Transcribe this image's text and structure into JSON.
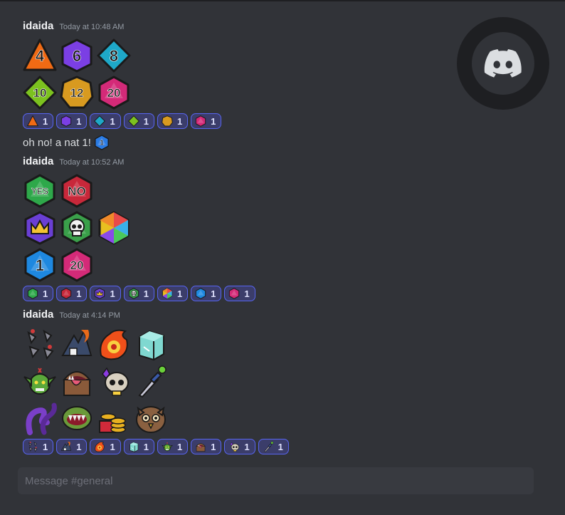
{
  "channel": {
    "composer_placeholder": "Message #general"
  },
  "colors": {
    "background": "#313338",
    "reaction_bg": "#3b3d6a",
    "reaction_border": "#5865f2",
    "username": "#f2f3f5",
    "timestamp": "#949ba4"
  },
  "messages": [
    {
      "author": "idaida",
      "time": "Today at 10:48 AM",
      "emoji_rows": [
        [
          {
            "icon": "d4-die",
            "label": "4",
            "color": "#f06a14"
          },
          {
            "icon": "d6-die",
            "label": "6",
            "color": "#7b3fe4"
          },
          {
            "icon": "d8-die",
            "label": "8",
            "color": "#1ea8c8"
          }
        ],
        [
          {
            "icon": "d10-die",
            "label": "10",
            "color": "#7cc21f"
          },
          {
            "icon": "d12-die",
            "label": "12",
            "color": "#d89a20"
          },
          {
            "icon": "d20-die",
            "label": "20",
            "color": "#d42a78"
          }
        ]
      ],
      "reactions": [
        {
          "icon": "d4-die",
          "count": "1",
          "color": "#f06a14"
        },
        {
          "icon": "d6-die",
          "count": "1",
          "color": "#7b3fe4"
        },
        {
          "icon": "d8-die",
          "count": "1",
          "color": "#1ea8c8"
        },
        {
          "icon": "d10-die",
          "count": "1",
          "color": "#7cc21f"
        },
        {
          "icon": "d12-die",
          "count": "1",
          "color": "#d89a20"
        },
        {
          "icon": "d20-die",
          "count": "1",
          "color": "#d42a78"
        }
      ],
      "followup_text": "oh no! a nat 1!",
      "followup_emoji": {
        "icon": "nat1-die",
        "color": "#2a7be4"
      }
    },
    {
      "author": "idaida",
      "time": "Today at 10:52 AM",
      "emoji_rows": [
        [
          {
            "icon": "yes-die",
            "label": "YES",
            "color": "#2ea84a"
          },
          {
            "icon": "no-die",
            "label": "NO",
            "color": "#c8283a"
          }
        ],
        [
          {
            "icon": "crown-die",
            "color": "#6a3fd4"
          },
          {
            "icon": "skull-die",
            "color": "#3aa04a"
          },
          {
            "icon": "rainbow-die",
            "color": "#e8c020"
          }
        ],
        [
          {
            "icon": "one-die",
            "label": "1",
            "color": "#1e88e0"
          },
          {
            "icon": "twenty-die",
            "label": "20",
            "color": "#d42a78"
          }
        ]
      ],
      "reactions": [
        {
          "icon": "yes-die",
          "count": "1",
          "color": "#2ea84a"
        },
        {
          "icon": "no-die",
          "count": "1",
          "color": "#c8283a"
        },
        {
          "icon": "crown-die",
          "count": "1",
          "color": "#6a3fd4"
        },
        {
          "icon": "skull-die",
          "count": "1",
          "color": "#3aa04a"
        },
        {
          "icon": "rainbow-die",
          "count": "1",
          "color": "#e8c020"
        },
        {
          "icon": "one-die",
          "count": "1",
          "color": "#1e88e0"
        },
        {
          "icon": "twenty-die",
          "count": "1",
          "color": "#d42a78"
        }
      ]
    },
    {
      "author": "idaida",
      "time": "Today at 4:14 PM",
      "emoji_rows": [
        [
          {
            "icon": "caltrops",
            "color": "#8a8a96"
          },
          {
            "icon": "fire-shark",
            "color": "#e86a1a"
          },
          {
            "icon": "fireball",
            "color": "#f0501a"
          },
          {
            "icon": "gelatinous-cube",
            "color": "#7fd8d0"
          }
        ],
        [
          {
            "icon": "goblin",
            "color": "#5aa83a"
          },
          {
            "icon": "mimic",
            "color": "#8a5a3a"
          },
          {
            "icon": "skull-gem",
            "color": "#d8d0c0"
          },
          {
            "icon": "dagger",
            "color": "#6ad03a"
          }
        ],
        [
          {
            "icon": "tentacle",
            "color": "#7a3fc8"
          },
          {
            "icon": "plant-trap",
            "color": "#6a9a3a"
          },
          {
            "icon": "treasure",
            "color": "#e8b020"
          },
          {
            "icon": "owlbear",
            "color": "#8a6040"
          }
        ]
      ],
      "reactions": [
        {
          "icon": "caltrops",
          "count": "1",
          "color": "#8a8a96"
        },
        {
          "icon": "fire-shark",
          "count": "1",
          "color": "#e86a1a"
        },
        {
          "icon": "fireball",
          "count": "1",
          "color": "#f0501a"
        },
        {
          "icon": "gelatinous-cube",
          "count": "1",
          "color": "#7fd8d0"
        },
        {
          "icon": "goblin",
          "count": "1",
          "color": "#5aa83a"
        },
        {
          "icon": "mimic",
          "count": "1",
          "color": "#8a5a3a"
        },
        {
          "icon": "skull-gem",
          "count": "1",
          "color": "#d8d0c0"
        },
        {
          "icon": "dagger",
          "count": "1",
          "color": "#6ad03a"
        }
      ]
    }
  ]
}
